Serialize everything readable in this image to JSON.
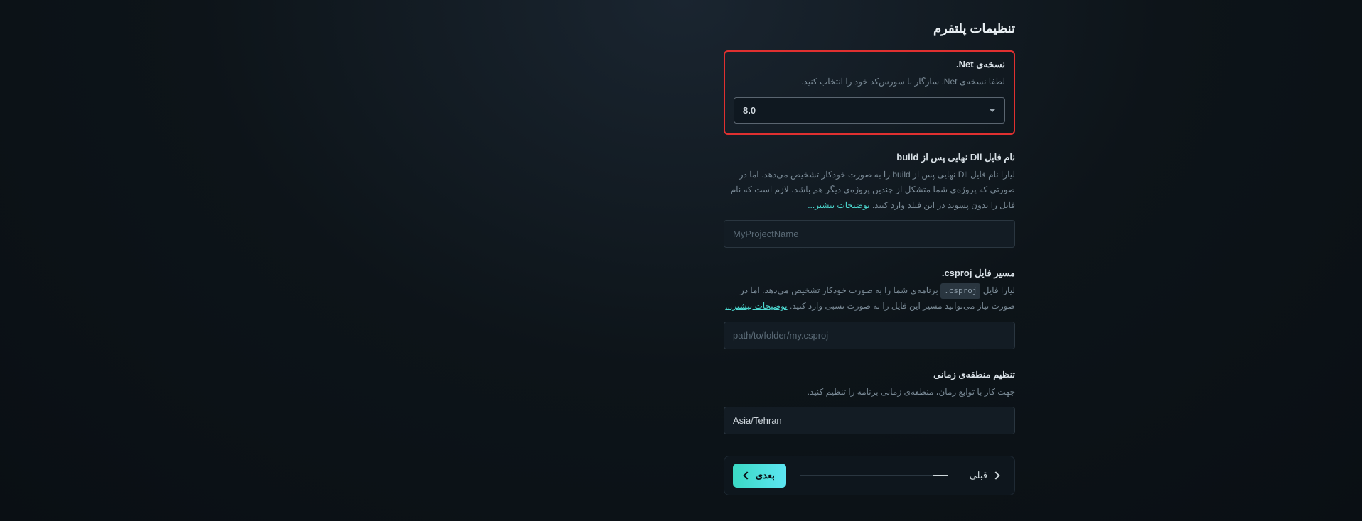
{
  "page": {
    "title": "تنظیمات پلتفرم"
  },
  "netVersion": {
    "label": "نسخه‌ی Net.",
    "description": "لطفا نسخه‌ی Net. سازگار با سورس‌کد خود را انتخاب کنید.",
    "value": "8.0"
  },
  "dllName": {
    "label": "نام فایل Dll نهایی پس از build",
    "descPart1": "لیارا نام فایل Dll نهایی پس از build را به صورت خودکار تشخیص می‌دهد. اما در صورتی که پروژه‌ی شما متشکل از چندین پروژه‌ی دیگر هم باشد، لازم است که نام فایل را بدون پسوند در این فیلد وارد کنید. ",
    "moreLabel": "توضیحات بیشتر...",
    "placeholder": "MyProjectName"
  },
  "csprojPath": {
    "label": "مسیر فایل csproj.",
    "descPrefix": "لیارا فایل ",
    "codeChip": ".csproj",
    "descMiddle": " برنامه‌ی شما را به صورت خودکار تشخیص می‌دهد. اما در صورت نیاز می‌توانید مسیر این فایل را به صورت نسبی وارد کنید. ",
    "moreLabel": "توضیحات بیشتر...",
    "placeholder": "path/to/folder/my.csproj"
  },
  "timezone": {
    "label": "تنظیم منطقه‌ی زمانی",
    "description": "جهت کار با توابع زمان، منطقه‌ی زمانی برنامه را تنظیم کنید.",
    "value": "Asia/Tehran"
  },
  "nav": {
    "prev": "قبلی",
    "next": "بعدی"
  }
}
